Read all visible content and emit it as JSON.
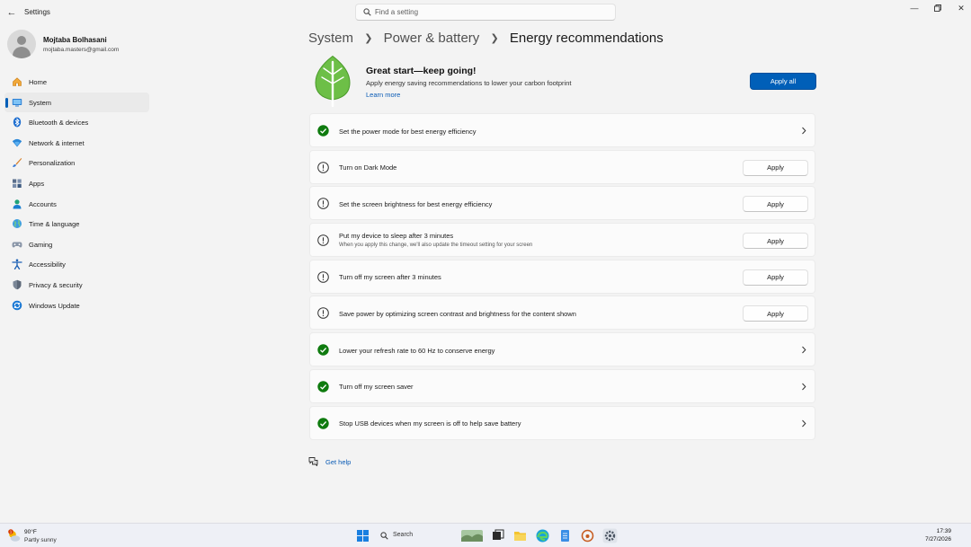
{
  "window": {
    "app_title": "Settings",
    "search_placeholder": "Find a setting"
  },
  "profile": {
    "name": "Mojtaba Bolhasani",
    "email": "mojtaba.masters@gmail.com"
  },
  "sidebar": {
    "items": [
      {
        "label": "Home",
        "icon": "home-icon"
      },
      {
        "label": "System",
        "icon": "display-icon",
        "active": true
      },
      {
        "label": "Bluetooth & devices",
        "icon": "bluetooth-icon"
      },
      {
        "label": "Network & internet",
        "icon": "wifi-icon"
      },
      {
        "label": "Personalization",
        "icon": "brush-icon"
      },
      {
        "label": "Apps",
        "icon": "apps-icon"
      },
      {
        "label": "Accounts",
        "icon": "person-icon"
      },
      {
        "label": "Time & language",
        "icon": "globe-icon"
      },
      {
        "label": "Gaming",
        "icon": "gamepad-icon"
      },
      {
        "label": "Accessibility",
        "icon": "accessibility-icon"
      },
      {
        "label": "Privacy & security",
        "icon": "shield-icon"
      },
      {
        "label": "Windows Update",
        "icon": "update-icon"
      }
    ]
  },
  "breadcrumb": {
    "level1": "System",
    "level2": "Power & battery",
    "current": "Energy recommendations"
  },
  "hero": {
    "title": "Great start—keep going!",
    "description": "Apply energy saving recommendations to lower your carbon footprint",
    "link": "Learn more",
    "apply_all_label": "Apply all"
  },
  "recommendations": [
    {
      "title": "Set the power mode for best energy efficiency",
      "status": "done"
    },
    {
      "title": "Turn on Dark Mode",
      "status": "pending",
      "action": "Apply"
    },
    {
      "title": "Set the screen brightness for best energy efficiency",
      "status": "pending",
      "action": "Apply"
    },
    {
      "title": "Put my device to sleep after 3 minutes",
      "subtitle": "When you apply this change, we'll also update the timeout setting for your screen",
      "status": "pending",
      "action": "Apply"
    },
    {
      "title": "Turn off my screen after 3 minutes",
      "status": "pending",
      "action": "Apply"
    },
    {
      "title": "Save power by optimizing screen contrast and brightness for the content shown",
      "status": "pending",
      "action": "Apply"
    },
    {
      "title": "Lower your refresh rate to 60 Hz to conserve energy",
      "status": "done"
    },
    {
      "title": "Turn off my screen saver",
      "status": "done"
    },
    {
      "title": "Stop USB devices when my screen is off to help save battery",
      "status": "done"
    }
  ],
  "help": {
    "label": "Get help"
  },
  "taskbar": {
    "weather_temp": "90°F",
    "weather_condition": "Partly sunny",
    "weather_badge": "1",
    "search_label": "Search",
    "time": "17:39",
    "date": "7/27/2026"
  },
  "colors": {
    "accent": "#005fb8",
    "success": "#0f7b0f",
    "leaf": "#5fb43a",
    "background": "#f3f3f3",
    "card": "#fbfbfb"
  }
}
